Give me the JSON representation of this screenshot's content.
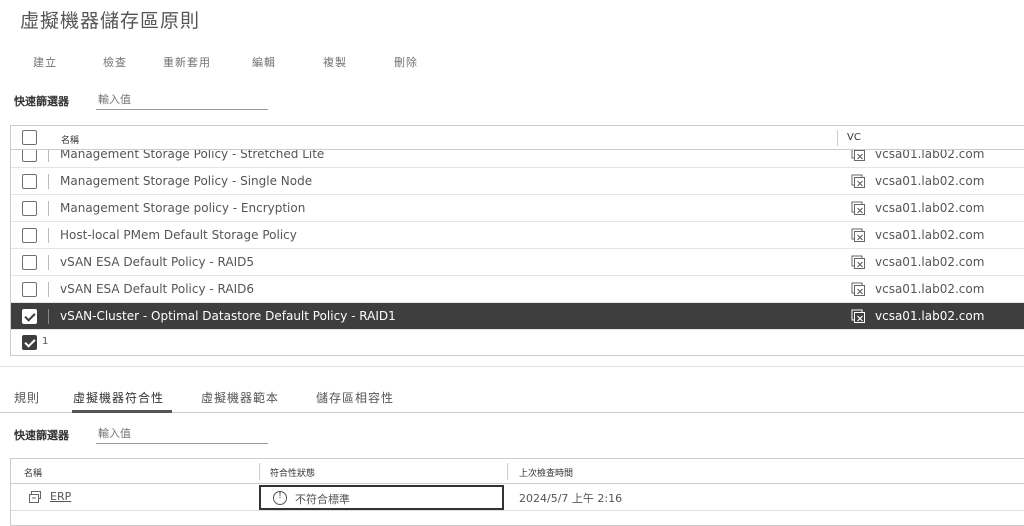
{
  "page": {
    "title": "虛擬機器儲存區原則"
  },
  "toolbar": {
    "create": "建立",
    "check": "檢查",
    "reapply": "重新套用",
    "edit": "編輯",
    "clone": "複製",
    "delete": "刪除"
  },
  "filter": {
    "label": "快速篩選器",
    "placeholder": "輸入值"
  },
  "policy_grid": {
    "columns": {
      "name": "名稱",
      "vc": "VC"
    },
    "rows": [
      {
        "name": "Management Storage Policy - Stretched Lite",
        "vc": "vcsa01.lab02.com",
        "selected": false
      },
      {
        "name": "Management Storage Policy - Single Node",
        "vc": "vcsa01.lab02.com",
        "selected": false
      },
      {
        "name": "Management Storage policy - Encryption",
        "vc": "vcsa01.lab02.com",
        "selected": false
      },
      {
        "name": "Host-local PMem Default Storage Policy",
        "vc": "vcsa01.lab02.com",
        "selected": false
      },
      {
        "name": "vSAN ESA Default Policy - RAID5",
        "vc": "vcsa01.lab02.com",
        "selected": false
      },
      {
        "name": "vSAN ESA Default Policy - RAID6",
        "vc": "vcsa01.lab02.com",
        "selected": false
      },
      {
        "name": "vSAN-Cluster - Optimal Datastore Default Policy - RAID1",
        "vc": "vcsa01.lab02.com",
        "selected": true
      }
    ],
    "selected_count": "1"
  },
  "tabs": [
    {
      "label": "規則"
    },
    {
      "label": "虛擬機器符合性"
    },
    {
      "label": "虛擬機器範本"
    },
    {
      "label": "儲存區相容性"
    }
  ],
  "compliance_filter": {
    "label": "快速篩選器",
    "placeholder": "輸入值"
  },
  "compliance_grid": {
    "columns": {
      "name": "名稱",
      "status": "符合性狀態",
      "last_checked": "上次檢查時間"
    },
    "rows": [
      {
        "name": "ERP",
        "status": "不符合標準",
        "last_checked": "2024/5/7 上午 2:16"
      }
    ]
  }
}
